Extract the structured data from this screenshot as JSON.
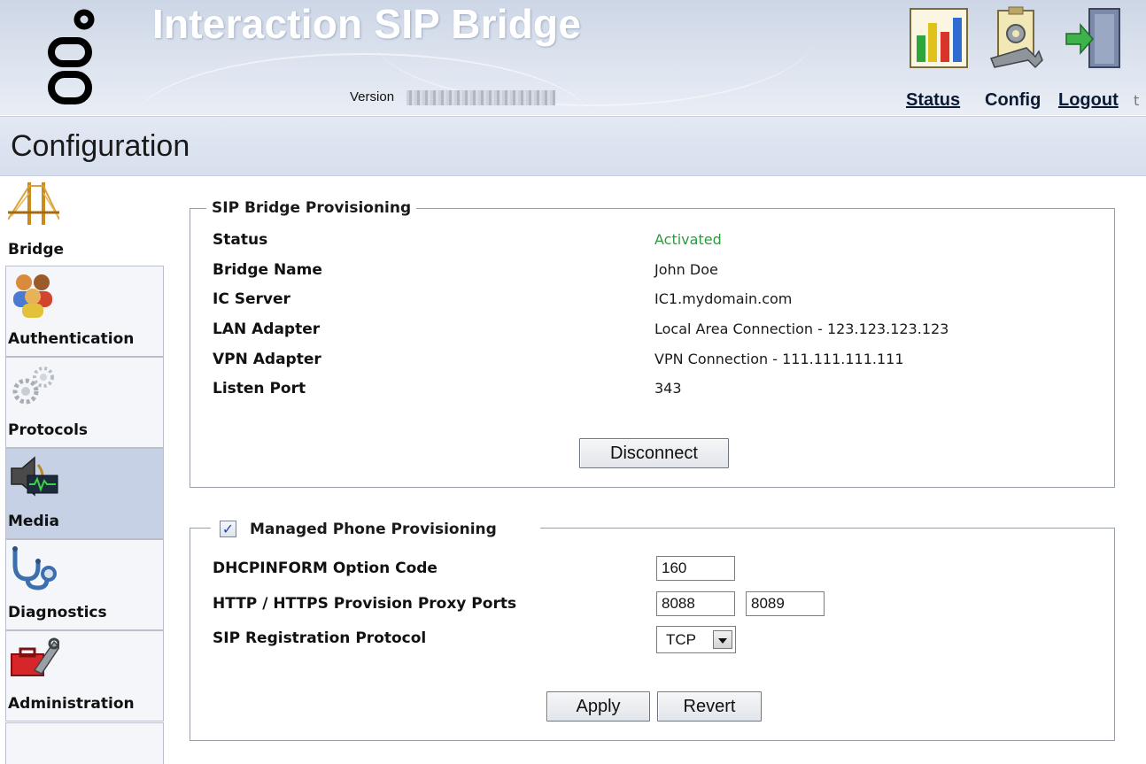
{
  "app": {
    "title": "Interaction SIP Bridge",
    "version_label": "Version",
    "version_value": ""
  },
  "header_nav": {
    "status": "Status",
    "config": "Config",
    "logout": "Logout",
    "trail": "t"
  },
  "icons": {
    "logo": "genesys-logo",
    "status": "bar-chart-icon",
    "config": "clipboard-wrench-icon",
    "logout": "door-exit-icon"
  },
  "page": {
    "title": "Configuration"
  },
  "sidebar": {
    "items": [
      {
        "label": "Bridge",
        "icon": "bridge-icon"
      },
      {
        "label": "Authentication",
        "icon": "users-icon"
      },
      {
        "label": "Protocols",
        "icon": "gears-icon"
      },
      {
        "label": "Media",
        "icon": "speaker-icon",
        "active": true
      },
      {
        "label": "Diagnostics",
        "icon": "stethoscope-icon"
      },
      {
        "label": "Administration",
        "icon": "toolbox-icon"
      }
    ]
  },
  "bridge_provisioning": {
    "legend": "SIP Bridge Provisioning",
    "rows": [
      {
        "label": "Status",
        "value": "Activated"
      },
      {
        "label": "Bridge Name",
        "value": "John Doe"
      },
      {
        "label": "IC Server",
        "value": "IC1.mydomain.com"
      },
      {
        "label": "LAN Adapter",
        "value": "Local Area Connection - 123.123.123.123"
      },
      {
        "label": "VPN Adapter",
        "value": "VPN Connection - 111.111.111.111"
      },
      {
        "label": "Listen Port",
        "value": "343"
      }
    ],
    "disconnect_label": "Disconnect"
  },
  "phone_provisioning": {
    "legend": "Managed Phone Provisioning",
    "enabled": true,
    "checkmark": "✓",
    "dhcp_label": "DHCPINFORM Option Code",
    "dhcp_value": "160",
    "proxy_label": "HTTP / HTTPS Provision Proxy Ports",
    "http_port": "8088",
    "https_port": "8089",
    "protocol_label": "SIP Registration Protocol",
    "protocol_value": "TCP",
    "apply_label": "Apply",
    "revert_label": "Revert"
  },
  "colors": {
    "activated": "#2e9a3e",
    "header_bg": "#d5dcea",
    "active_nav": "#c7d1e6"
  }
}
